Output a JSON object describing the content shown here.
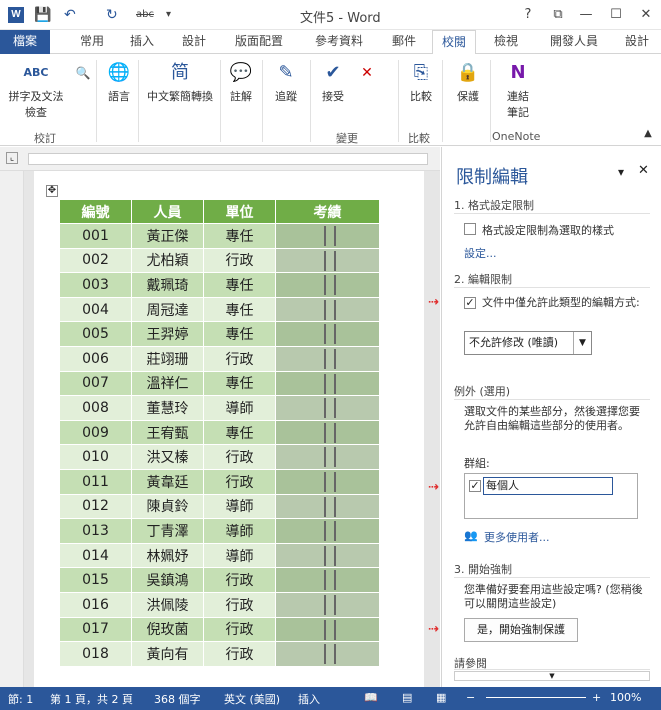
{
  "window": {
    "title": "文件5 - Word",
    "qat_undo": "↶",
    "qat_redo": "↻",
    "qat_abc": "abc",
    "help": "?",
    "ribbon_display": "⧉",
    "minimize": "—",
    "maximize": "☐",
    "close": "✕"
  },
  "tabs": [
    {
      "label": "檔案"
    },
    {
      "label": "常用"
    },
    {
      "label": "插入"
    },
    {
      "label": "設計"
    },
    {
      "label": "版面配置"
    },
    {
      "label": "參考資料"
    },
    {
      "label": "郵件"
    },
    {
      "label": "校閱"
    },
    {
      "label": "檢視"
    },
    {
      "label": "開發人員"
    },
    {
      "label": "設計"
    }
  ],
  "ribbon": {
    "spell_label": "拼字及文法\n檢查",
    "spell_icon": "ABC",
    "group_proofing": "校訂",
    "language": "語言",
    "chinese_convert": "中文繁簡轉換",
    "comment": "註解",
    "tracking": "追蹤",
    "accept": "接受",
    "group_changes": "變更",
    "compare": "比較",
    "group_compare": "比較",
    "protect": "保護",
    "onenote": "連結\n筆記",
    "group_onenote": "OneNote"
  },
  "table": {
    "headers": [
      "編號",
      "人員",
      "單位",
      "考績"
    ],
    "rows": [
      [
        "001",
        "黃正傑",
        "專任"
      ],
      [
        "002",
        "尤柏穎",
        "行政"
      ],
      [
        "003",
        "戴珮琦",
        "專任"
      ],
      [
        "004",
        "周冠達",
        "專任"
      ],
      [
        "005",
        "王羿婷",
        "專任"
      ],
      [
        "006",
        "莊翊珊",
        "行政"
      ],
      [
        "007",
        "溫祥仁",
        "專任"
      ],
      [
        "008",
        "董慧玲",
        "導師"
      ],
      [
        "009",
        "王宥甄",
        "專任"
      ],
      [
        "010",
        "洪又榛",
        "行政"
      ],
      [
        "011",
        "黃韋廷",
        "行政"
      ],
      [
        "012",
        "陳貞鈴",
        "導師"
      ],
      [
        "013",
        "丁青澤",
        "導師"
      ],
      [
        "014",
        "林姵妤",
        "導師"
      ],
      [
        "015",
        "吳鎮鴻",
        "行政"
      ],
      [
        "016",
        "洪佩陵",
        "行政"
      ],
      [
        "017",
        "倪玫菌",
        "行政"
      ],
      [
        "018",
        "黃向有",
        "行政"
      ]
    ]
  },
  "pane": {
    "title": "限制編輯",
    "sec1": "1. 格式設定限制",
    "sec1_option": "格式設定限制為選取的樣式",
    "sec1_link": "設定...",
    "sec2": "2. 編輯限制",
    "sec2_option": "文件中僅允許此類型的編輯方式:",
    "sec2_dropdown": "不允許修改 (唯讀)",
    "exceptions": "例外 (選用)",
    "exceptions_desc": "選取文件的某些部分，然後選擇您要允許自由編輯這些部分的使用者。",
    "groups_label": "群組:",
    "everyone": "每個人",
    "more_users": "更多使用者...",
    "sec3": "3. 開始強制",
    "sec3_desc": "您準備好要套用這些設定嗎? (您稍後可以關閉這些設定)",
    "start_button": "是，開始強制保護",
    "see_also": "請參閱"
  },
  "status": {
    "section": "節: 1",
    "page": "第 1 頁，共 2 頁",
    "words": "368 個字",
    "language": "英文 (美國)",
    "mode": "插入",
    "zoom": "100%"
  },
  "colors": {
    "accent": "#2b579a",
    "table_header": "#70ad47",
    "row_dark": "#c5dfb4",
    "row_light": "#e2efd9",
    "arrow": "#e03030"
  }
}
